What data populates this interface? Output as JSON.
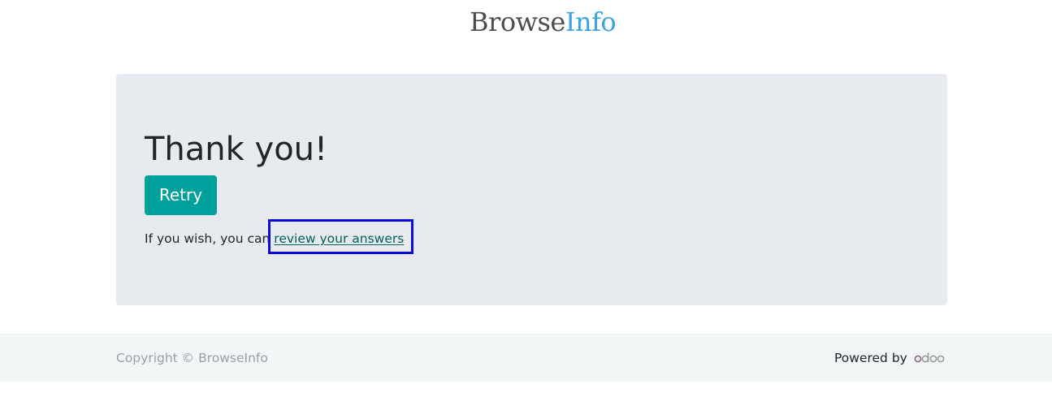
{
  "header": {
    "logo_part1": "Browse",
    "logo_part2": "Info"
  },
  "card": {
    "title": "Thank you!",
    "retry_label": "Retry",
    "review_prefix": "If you wish, you can",
    "review_link": "review your answers"
  },
  "footer": {
    "copyright": "Copyright © BrowseInfo",
    "powered_by": "Powered by",
    "odoo_logo": "odoo"
  },
  "colors": {
    "accent": "#00a09d",
    "card_bg": "#e7ebef",
    "footer_bg": "#f3f6f7",
    "logo_blue": "#3aa3e3",
    "highlight": "#0a0adc"
  }
}
